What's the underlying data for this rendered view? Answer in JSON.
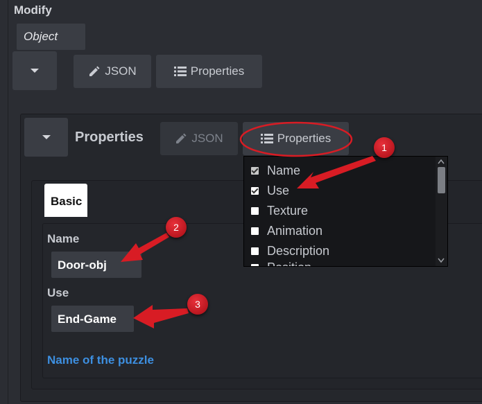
{
  "modify": {
    "title": "Modify",
    "object_label": "Object",
    "json_button": "JSON",
    "properties_button": "Properties"
  },
  "properties_panel": {
    "title": "Properties",
    "json_button": "JSON",
    "properties_button": "Properties"
  },
  "tabs": {
    "basic": "Basic"
  },
  "form": {
    "name_label": "Name",
    "name_value": "Door-obj",
    "use_label": "Use",
    "use_value": "End-Game",
    "link": "Name of the puzzle"
  },
  "dropdown": {
    "items": [
      {
        "label": "Name",
        "checked": true
      },
      {
        "label": "Use",
        "checked": true
      },
      {
        "label": "Texture",
        "checked": false
      },
      {
        "label": "Animation",
        "checked": false
      },
      {
        "label": "Description",
        "checked": false
      },
      {
        "label": "Position",
        "checked": false
      }
    ]
  },
  "annotations": [
    "1",
    "2",
    "3"
  ],
  "colors": {
    "accent_red": "#d81c24",
    "link_blue": "#3d8fe0",
    "bg": "#2b2d33"
  }
}
